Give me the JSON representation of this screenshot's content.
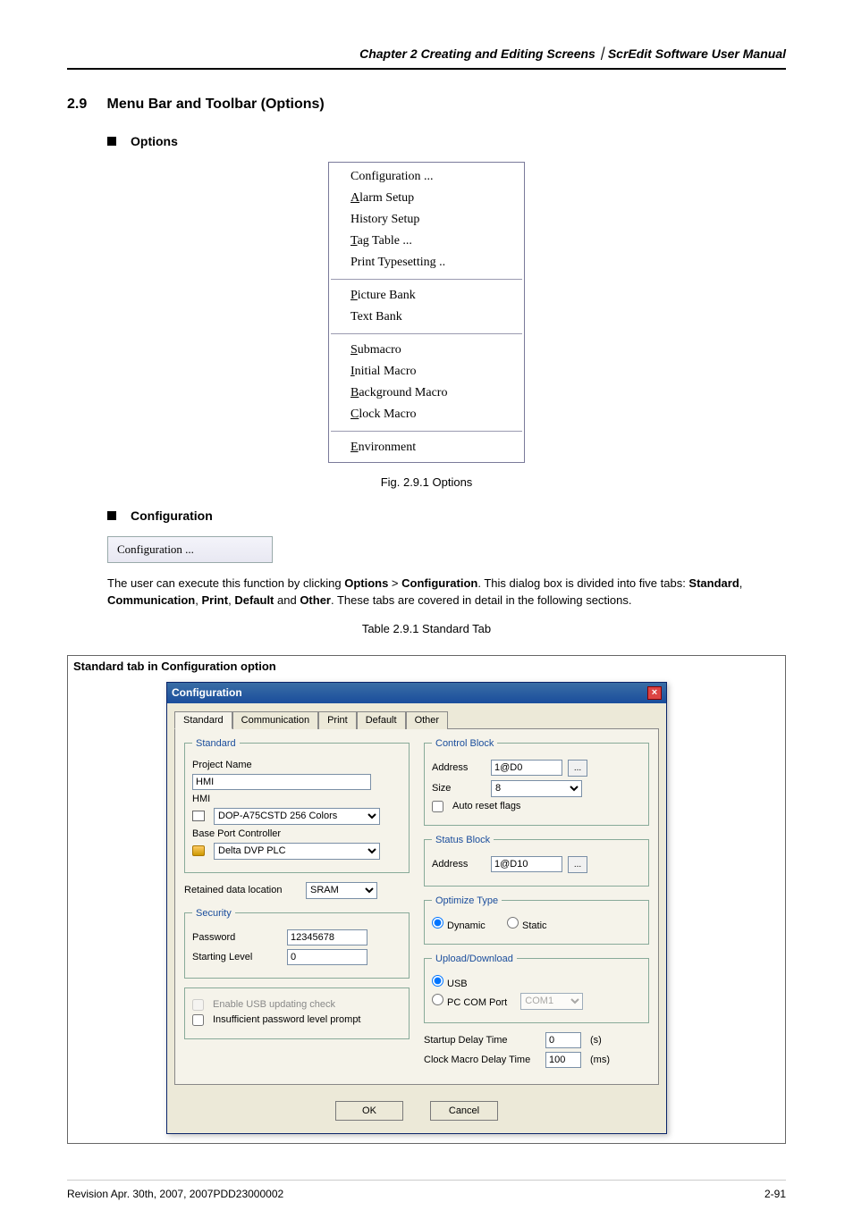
{
  "header": "Chapter 2  Creating and Editing Screens｜ScrEdit Software User Manual",
  "section_num": "2.9",
  "section_title": "Menu Bar and Toolbar (Options)",
  "bullet_options": "Options",
  "options_menu": {
    "group1": [
      "Configuration ...",
      "Alarm Setup",
      "History Setup",
      "Tag Table ...",
      "Print Typesetting .."
    ],
    "group2": [
      "Picture Bank",
      "Text Bank"
    ],
    "group3": [
      "Submacro",
      "Initial Macro",
      "Background Macro",
      "Clock Macro"
    ],
    "group4": [
      "Environment"
    ]
  },
  "fig_caption": "Fig. 2.9.1 Options",
  "bullet_config": "Configuration",
  "config_menu_item": "Configuration ...",
  "para_parts": {
    "p1a": "The user can execute this function by clicking ",
    "p1b": "Options",
    "p1c": " > ",
    "p1d": "Configuration",
    "p1e": ". This dialog box is divided into five tabs: ",
    "p1f": "Standard",
    "p1g": ", ",
    "p1h": "Communication",
    "p1i": ", ",
    "p1j": "Print",
    "p1k": ", ",
    "p1l": "Default",
    "p1m": " and ",
    "p1n": "Other",
    "p1o": ". These tabs are covered in detail in the following sections."
  },
  "table_caption": "Table 2.9.1 Standard Tab",
  "table_header": "Standard tab in Configuration option",
  "dialog": {
    "title": "Configuration",
    "tabs": [
      "Standard",
      "Communication",
      "Print",
      "Default",
      "Other"
    ],
    "standard_legend": "Standard",
    "project_name_label": "Project Name",
    "project_name_value": "HMI",
    "hmi_label": "HMI",
    "hmi_value": "DOP-A75CSTD 256 Colors",
    "bpc_label": "Base Port Controller",
    "bpc_value": "Delta DVP PLC",
    "retained_label": "Retained data location",
    "retained_value": "SRAM",
    "security_legend": "Security",
    "password_label": "Password",
    "password_value": "12345678",
    "startlvl_label": "Starting Level",
    "startlvl_value": "0",
    "enable_usb_label": "Enable USB updating check",
    "insuff_pw_label": "Insufficient password level prompt",
    "ctrl_legend": "Control Block",
    "ctrl_addr_label": "Address",
    "ctrl_addr_value": "1@D0",
    "ctrl_size_label": "Size",
    "ctrl_size_value": "8",
    "auto_reset_label": "Auto reset flags",
    "status_legend": "Status Block",
    "status_addr_label": "Address",
    "status_addr_value": "1@D10",
    "opt_legend": "Optimize Type",
    "opt_dyn": "Dynamic",
    "opt_static": "Static",
    "upl_legend": "Upload/Download",
    "upl_usb": "USB",
    "upl_pc": "PC COM Port",
    "upl_com_value": "COM1",
    "startup_label": "Startup Delay Time",
    "startup_value": "0",
    "startup_unit": "(s)",
    "clock_label": "Clock Macro Delay Time",
    "clock_value": "100",
    "clock_unit": "(ms)",
    "ok": "OK",
    "cancel": "Cancel"
  },
  "footer_left": "Revision Apr. 30th, 2007, 2007PDD23000002",
  "footer_right": "2-91"
}
